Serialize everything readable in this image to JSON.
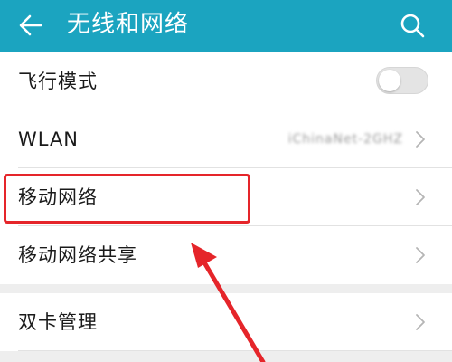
{
  "appbar": {
    "title": "无线和网络",
    "background_color": "#1ba4c0",
    "back_icon": "arrow-left-icon",
    "search_icon": "search-icon"
  },
  "settings": {
    "airplane_mode": {
      "label": "飞行模式",
      "enabled": false
    },
    "wlan": {
      "label": "WLAN",
      "value": "iChinaNet-2GHZ"
    },
    "mobile_network": {
      "label": "移动网络"
    },
    "tethering": {
      "label": "移动网络共享"
    },
    "dual_sim": {
      "label": "双卡管理"
    }
  },
  "annotation": {
    "highlight_color": "#e5252a",
    "highlighted_item": "移动网络"
  }
}
